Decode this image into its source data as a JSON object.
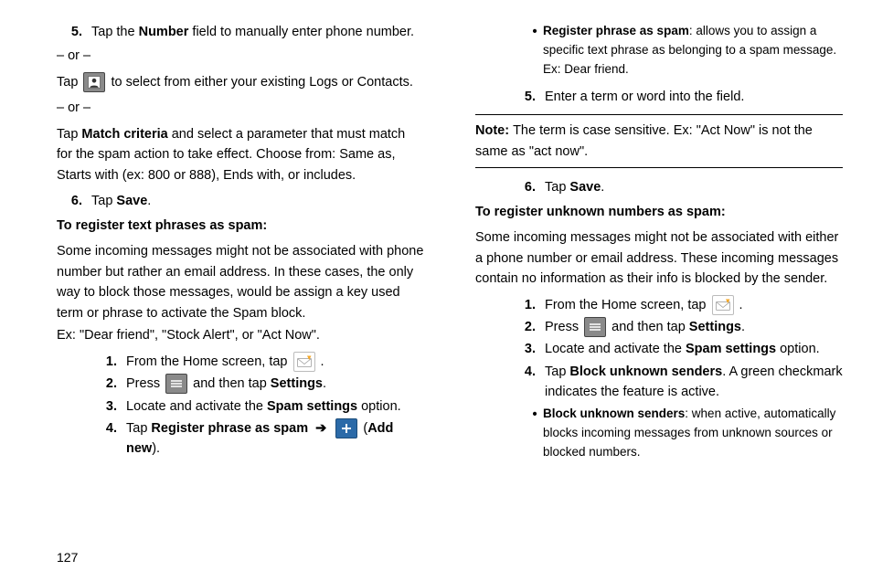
{
  "pageNumber": "127",
  "left": {
    "s5": {
      "num": "5.",
      "line1a": "Tap the ",
      "line1b": "Number",
      "line1c": " field to manually enter phone number.",
      "or1": "– or –",
      "line2a": "Tap ",
      "line2b": " to select from either your existing Logs or Contacts.",
      "or2": "– or –",
      "line3a": "Tap ",
      "line3b": "Match criteria",
      "line3c": " and select a parameter that must match for the spam action to take effect. Choose from: Same as, Starts with (ex: 800 or 888), Ends with, or includes."
    },
    "s6": {
      "num": "6.",
      "a": "Tap ",
      "b": "Save",
      "c": "."
    },
    "hdr_phrases": "To register text phrases as spam:",
    "para_phrases_a": "Some incoming messages might not be associated with phone number but rather an email address. In these cases, the only way to block those messages, would be assign a key used term or phrase to activate the Spam block.",
    "para_phrases_b": "Ex: \"Dear friend\", \"Stock Alert\", or \"Act Now\".",
    "p1": {
      "num": "1.",
      "a": "From the Home screen, tap ",
      "b": "."
    },
    "p2": {
      "num": "2.",
      "a": "Press ",
      "b": " and then tap ",
      "c": "Settings",
      "d": "."
    },
    "p3": {
      "num": "3.",
      "a": "Locate and activate the ",
      "b": "Spam settings",
      "c": " option."
    },
    "p4": {
      "num": "4.",
      "a": "Tap ",
      "b": "Register phrase as spam",
      "c": " ",
      "d": " (",
      "e": "Add new",
      "f": ")."
    }
  },
  "right": {
    "bullet1": {
      "a": "Register phrase as spam",
      "b": ": allows you to assign a specific text phrase as belonging to a spam message. Ex: Dear friend."
    },
    "r5": {
      "num": "5.",
      "a": "Enter a term or word into the field."
    },
    "note": {
      "label": "Note:",
      "body": "The term is case sensitive. Ex: \"Act Now\" is not the same as \"act now\"."
    },
    "r6": {
      "num": "6.",
      "a": "Tap ",
      "b": "Save",
      "c": "."
    },
    "hdr_unknown": "To register unknown numbers as spam:",
    "para_unknown": "Some incoming messages might not be associated with either a phone number or email address. These incoming messages contain no information as their info is blocked by the sender.",
    "u1": {
      "num": "1.",
      "a": "From the Home screen, tap ",
      "b": "."
    },
    "u2": {
      "num": "2.",
      "a": "Press ",
      "b": " and then tap ",
      "c": "Settings",
      "d": "."
    },
    "u3": {
      "num": "3.",
      "a": "Locate and activate the ",
      "b": "Spam settings",
      "c": " option."
    },
    "u4": {
      "num": "4.",
      "a": "Tap ",
      "b": "Block unknown senders",
      "c": ". A green checkmark indicates the feature is active."
    },
    "bullet2": {
      "a": "Block unknown senders",
      "b": ": when active, automatically blocks incoming messages from unknown sources or blocked numbers."
    }
  }
}
